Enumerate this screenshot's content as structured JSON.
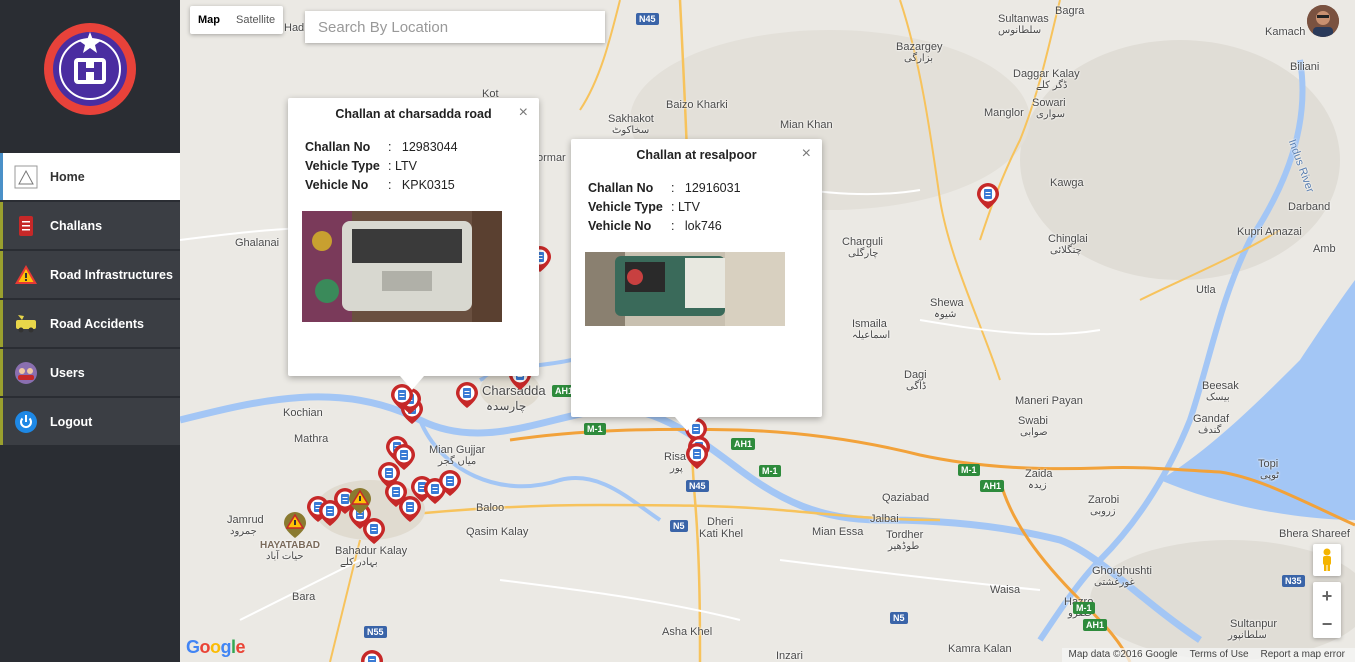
{
  "sidebar": {
    "items": [
      {
        "label": "Home",
        "icon": "home-icon"
      },
      {
        "label": "Challans",
        "icon": "challans-icon"
      },
      {
        "label": "Road Infrastructures",
        "icon": "warning-icon"
      },
      {
        "label": "Road Accidents",
        "icon": "accident-icon"
      },
      {
        "label": "Users",
        "icon": "users-icon"
      },
      {
        "label": "Logout",
        "icon": "power-icon"
      }
    ]
  },
  "map": {
    "type_options": [
      "Map",
      "Satellite"
    ],
    "search_placeholder": "Search By Location",
    "places": [
      {
        "name": "Kot",
        "cls": ""
      },
      {
        "name": "Sakhakot",
        "cls": ""
      },
      {
        "name": "سخاکوٹ",
        "cls": "sm"
      },
      {
        "name": "Baizo Kharki",
        "cls": ""
      },
      {
        "name": "Mian Khan",
        "cls": ""
      },
      {
        "name": "Bazargey",
        "cls": ""
      },
      {
        "name": "بزارگی",
        "cls": "sm"
      },
      {
        "name": "Sultanwas",
        "cls": ""
      },
      {
        "name": "سلطانوس",
        "cls": "sm"
      },
      {
        "name": "Bagra",
        "cls": ""
      },
      {
        "name": "Kamach",
        "cls": ""
      },
      {
        "name": "Biliani",
        "cls": ""
      },
      {
        "name": "Daggar Kalay",
        "cls": ""
      },
      {
        "name": "ڈگر کلے",
        "cls": "sm"
      },
      {
        "name": "Sowari",
        "cls": ""
      },
      {
        "name": "سواری",
        "cls": "sm"
      },
      {
        "name": "Manglor",
        "cls": ""
      },
      {
        "name": "Kawga",
        "cls": ""
      },
      {
        "name": "Indus River",
        "cls": ""
      },
      {
        "name": "Darband",
        "cls": ""
      },
      {
        "name": "Kupri Amazai",
        "cls": ""
      },
      {
        "name": "Amb",
        "cls": ""
      },
      {
        "name": "Chinglai",
        "cls": ""
      },
      {
        "name": "چنگلائی",
        "cls": "sm"
      },
      {
        "name": "Charguli",
        "cls": ""
      },
      {
        "name": "چارگلی",
        "cls": "sm"
      },
      {
        "name": "Shewa",
        "cls": ""
      },
      {
        "name": "شیوہ",
        "cls": "sm"
      },
      {
        "name": "Utla",
        "cls": ""
      },
      {
        "name": "Ismaila",
        "cls": ""
      },
      {
        "name": "اسماعیلہ",
        "cls": "sm"
      },
      {
        "name": "Dagi",
        "cls": ""
      },
      {
        "name": "ڈاگی",
        "cls": "sm"
      },
      {
        "name": "Beesak",
        "cls": ""
      },
      {
        "name": "بیسک",
        "cls": "sm"
      },
      {
        "name": "Maneri Payan",
        "cls": ""
      },
      {
        "name": "Swabi",
        "cls": ""
      },
      {
        "name": "صوابی",
        "cls": "sm"
      },
      {
        "name": "Gandaf",
        "cls": ""
      },
      {
        "name": "گندف",
        "cls": "sm"
      },
      {
        "name": "Topi",
        "cls": ""
      },
      {
        "name": "ٹوپی",
        "cls": "sm"
      },
      {
        "name": "Zaida",
        "cls": ""
      },
      {
        "name": "زیدہ",
        "cls": "sm"
      },
      {
        "name": "Zarobi",
        "cls": ""
      },
      {
        "name": "زروبی",
        "cls": "sm"
      },
      {
        "name": "Bhera Shareef",
        "cls": ""
      },
      {
        "name": "Qaziabad",
        "cls": ""
      },
      {
        "name": "Jalbai",
        "cls": ""
      },
      {
        "name": "Tordher",
        "cls": ""
      },
      {
        "name": "طوڈھیر",
        "cls": "sm"
      },
      {
        "name": "Mian Essa",
        "cls": ""
      },
      {
        "name": "Dheri",
        "cls": ""
      },
      {
        "name": "Kati Khel",
        "cls": ""
      },
      {
        "name": "Waisa",
        "cls": ""
      },
      {
        "name": "Ghorghushti",
        "cls": ""
      },
      {
        "name": "غورغشتی",
        "cls": "sm"
      },
      {
        "name": "Hazro",
        "cls": ""
      },
      {
        "name": "حضرو",
        "cls": "sm"
      },
      {
        "name": "Sultanpur",
        "cls": ""
      },
      {
        "name": "سلطانپور",
        "cls": "sm"
      },
      {
        "name": "Kamra Kalan",
        "cls": ""
      },
      {
        "name": "Asha Khel",
        "cls": ""
      },
      {
        "name": "Inzari",
        "cls": ""
      },
      {
        "name": "Ghalanai",
        "cls": ""
      },
      {
        "name": "Kochian",
        "cls": ""
      },
      {
        "name": "Mathra",
        "cls": ""
      },
      {
        "name": "Mian Gujjar",
        "cls": ""
      },
      {
        "name": "میاں گجر",
        "cls": "sm"
      },
      {
        "name": "Charsadda",
        "cls": ""
      },
      {
        "name": "چارسدہ",
        "cls": ""
      },
      {
        "name": "Baloo",
        "cls": ""
      },
      {
        "name": "Qasim Kalay",
        "cls": ""
      },
      {
        "name": "Jamrud",
        "cls": ""
      },
      {
        "name": "جمرود",
        "cls": "sm"
      },
      {
        "name": "HAYATABAD",
        "cls": "sm"
      },
      {
        "name": "حیات آباد",
        "cls": "sm"
      },
      {
        "name": "Bahadur Kalay",
        "cls": ""
      },
      {
        "name": "بہادر کلے",
        "cls": "sm"
      },
      {
        "name": "Bara",
        "cls": ""
      },
      {
        "name": "Had",
        "cls": ""
      },
      {
        "name": "ormar",
        "cls": ""
      },
      {
        "name": "Risa",
        "cls": ""
      },
      {
        "name": "پور",
        "cls": "sm"
      }
    ],
    "roads": [
      "N45",
      "M-1",
      "AH1",
      "N5",
      "N55",
      "N35"
    ]
  },
  "infowindows": [
    {
      "title": "Challan at charsadda road",
      "challan_label": "Challan No",
      "challan_no": "12983044",
      "vehicle_type_label": "Vehicle Type",
      "vehicle_type": "LTV",
      "vehicle_no_label": "Vehicle No",
      "vehicle_no": "KPK0315",
      "close": "×"
    },
    {
      "title": "Challan at resalpoor",
      "challan_label": "Challan No",
      "challan_no": "12916031",
      "vehicle_type_label": "Vehicle Type",
      "vehicle_type": "LTV",
      "vehicle_no_label": "Vehicle No",
      "vehicle_no": "lok746",
      "close": "×"
    }
  ],
  "controls": {
    "zoom_in": "+",
    "zoom_out": "−"
  },
  "footer": {
    "google": "Google",
    "map_data": "Map data ©2016 Google",
    "terms": "Terms of Use",
    "report": "Report a map error"
  },
  "colors": {
    "sidebar_bg": "#2a2d33",
    "marker_red": "#c62828",
    "water": "#a3c6f5",
    "motorway": "#f2a23a"
  }
}
